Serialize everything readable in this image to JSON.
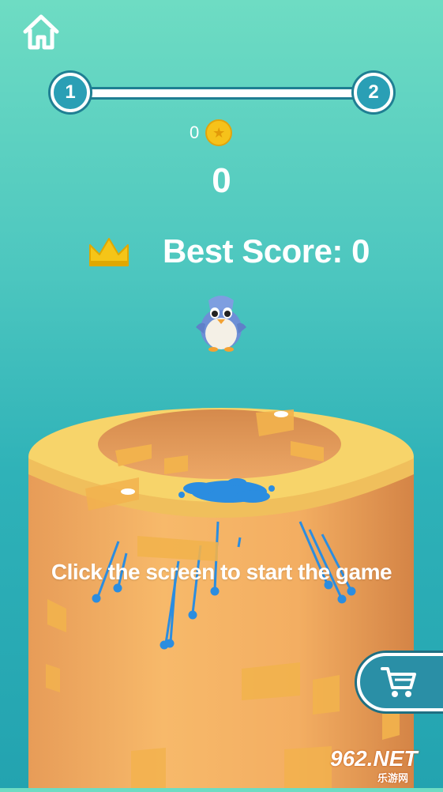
{
  "progress": {
    "current_level": "1",
    "next_level": "2"
  },
  "coins": {
    "count": "0"
  },
  "score": {
    "value": "0"
  },
  "best_score": {
    "label": "Best Score: 0"
  },
  "prompt": {
    "text": "Click the screen to start the game"
  },
  "icons": {
    "home": "home-icon",
    "coin": "star-coin-icon",
    "crown": "crown-icon",
    "cart": "shopping-cart-icon",
    "player": "penguin-character"
  },
  "watermark": {
    "main": "962.NET",
    "sub": "乐游网"
  },
  "colors": {
    "sky_top": "#6edcc3",
    "sky_bottom": "#23a3b0",
    "tower": "#f0a85a",
    "tower_top": "#f7d46a",
    "splash": "#2b8de0",
    "crown": "#f5c518",
    "ui_dark": "#1f7f93"
  }
}
